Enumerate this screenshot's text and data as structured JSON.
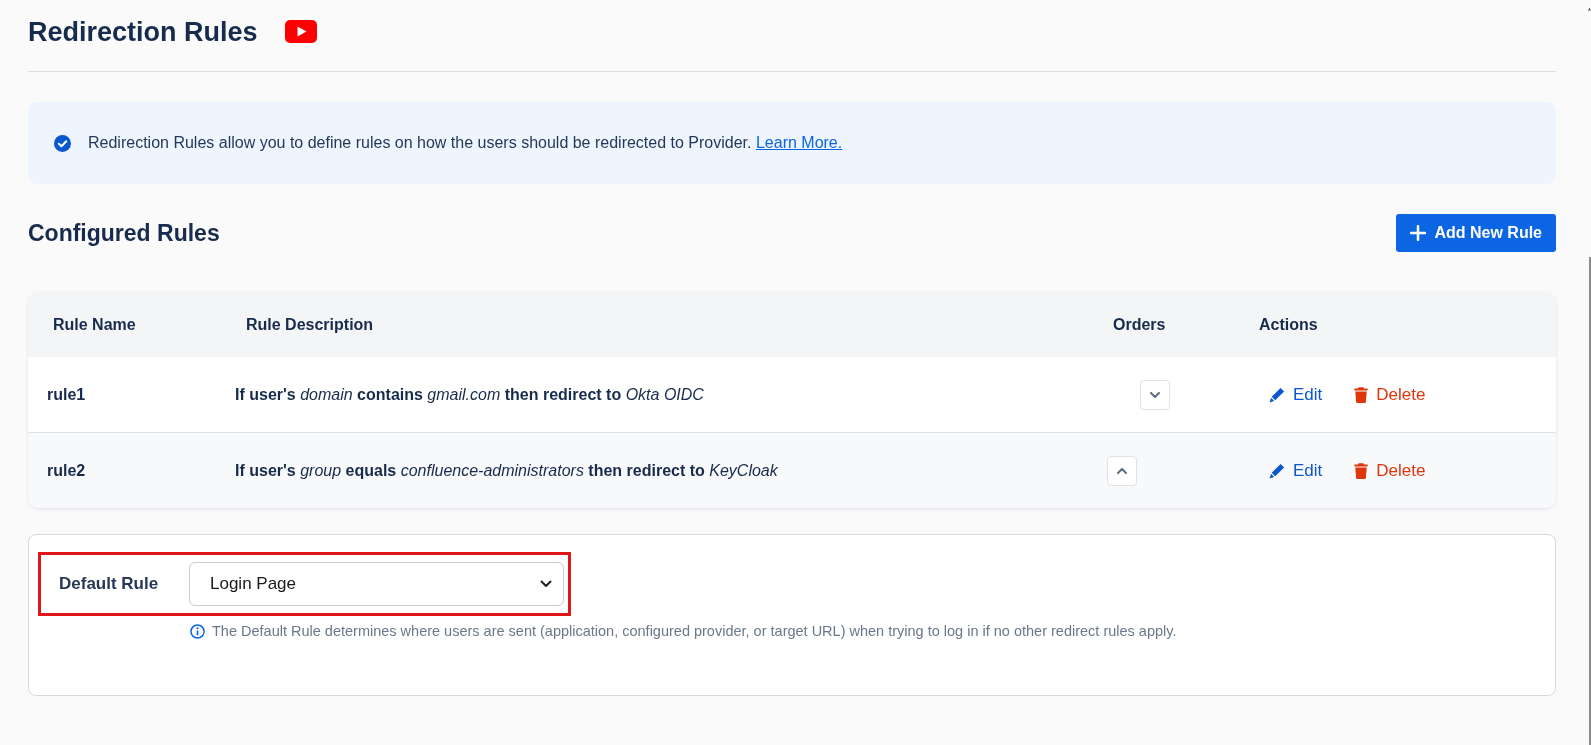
{
  "page": {
    "title": "Redirection Rules"
  },
  "info_banner": {
    "text": "Redirection Rules allow you to define rules on how the users should be redirected to Provider.",
    "link": "Learn More."
  },
  "section": {
    "title": "Configured Rules",
    "add_button": "Add New Rule"
  },
  "table": {
    "columns": [
      "Rule Name",
      "Rule Description",
      "Orders",
      "Actions"
    ],
    "rows": [
      {
        "name": "rule1",
        "description": "**If user's** *domain* **contains** *gmail.com* **then redirect to** *Okta OIDC*",
        "move_up": false,
        "move_down": true,
        "actions": [
          {
            "kind": "edit",
            "label": "Edit"
          },
          {
            "kind": "delete",
            "label": "Delete"
          }
        ]
      },
      {
        "name": "rule2",
        "description": "**If user's** *group* **equals** *confluence-administrators* **then redirect to** *KeyCloak*",
        "move_up": true,
        "move_down": false,
        "actions": [
          {
            "kind": "edit",
            "label": "Edit"
          },
          {
            "kind": "delete",
            "label": "Delete"
          }
        ]
      }
    ]
  },
  "default_rule": {
    "label": "Default Rule",
    "value": "Login Page",
    "highlighted": true,
    "hint": "The Default Rule determines where users are sent (application, configured provider, or target URL) when trying to log in if no other redirect rules apply."
  }
}
